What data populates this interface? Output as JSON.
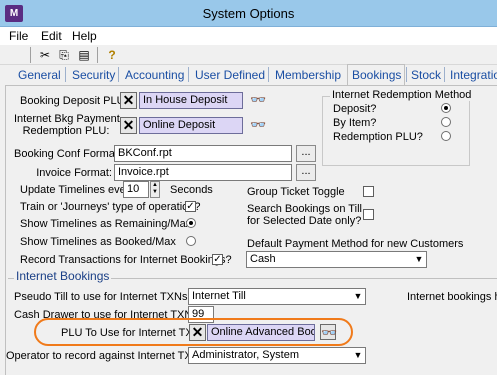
{
  "window": {
    "title": "System Options",
    "app_icon_text": "M"
  },
  "menu": [
    "File",
    "Edit",
    "Help"
  ],
  "toolbar": {
    "icons": [
      "cut-icon",
      "copy-icon",
      "paste-icon",
      "help-icon"
    ],
    "cut": "✂",
    "copy": "⎘",
    "paste": "▤",
    "help": "?"
  },
  "tabs": [
    "General",
    "Security",
    "Accounting",
    "User Defined",
    "Membership",
    "Bookings",
    "Stock",
    "Integratio"
  ],
  "active_tab": "Bookings",
  "booking": {
    "deposit_plu_label": "Booking Deposit PLU:",
    "deposit_plu_value": "In House Deposit",
    "internet_bkg_label_1": "Internet Bkg Payment",
    "internet_bkg_label_2": "Redemption PLU:",
    "internet_bkg_value": "Online Deposit",
    "conf_format_label": "Booking Conf Format:",
    "conf_format_value": "BKConf.rpt",
    "invoice_format_label": "Invoice Format:",
    "invoice_format_value": "Invoice.rpt",
    "dots": "...",
    "update_timelines_label": "Update Timelines every:",
    "update_timelines_value": "10",
    "update_timelines_unit": "Seconds",
    "train_label": "Train or 'Journeys' type of operation?",
    "train_checked": true,
    "show_remaining_label": "Show Timelines as Remaining/Max",
    "show_booked_label": "Show Timelines as Booked/Max",
    "show_remaining_selected": true,
    "record_txn_label": "Record Transactions for Internet Bookings?",
    "record_txn_checked": true,
    "group_ticket_label": "Group Ticket Toggle",
    "group_ticket_checked": false,
    "search_bookings_label_1": "Search Bookings on Till",
    "search_bookings_label_2": "for Selected Date only?",
    "search_bookings_checked": false,
    "default_payment_label": "Default Payment Method for new Customers",
    "default_payment_value": "Cash",
    "check_mark": "✓",
    "x_mark": "✕",
    "binoculars": "👓",
    "arrow_down": "▼",
    "spin_up": "▲",
    "spin_down": "▼"
  },
  "redemption_method": {
    "title": "Internet Redemption Method",
    "options": [
      "Deposit?",
      "By Item?",
      "Redemption PLU?"
    ],
    "selected": "Deposit?"
  },
  "internet_bookings": {
    "title": "Internet Bookings",
    "pseudo_till_label": "Pseudo Till to use for Internet TXNs:",
    "pseudo_till_value": "Internet Till",
    "hidden_note": "Internet bookings hidd",
    "cash_drawer_label": "Cash Drawer to use for Internet TXNs:",
    "cash_drawer_value": "99",
    "plu_label": "PLU To Use for Internet TXNs:",
    "plu_value": "Online Advanced Book",
    "operator_label": "Operator to record against Internet TXNs:",
    "operator_value": "Administrator, System"
  }
}
